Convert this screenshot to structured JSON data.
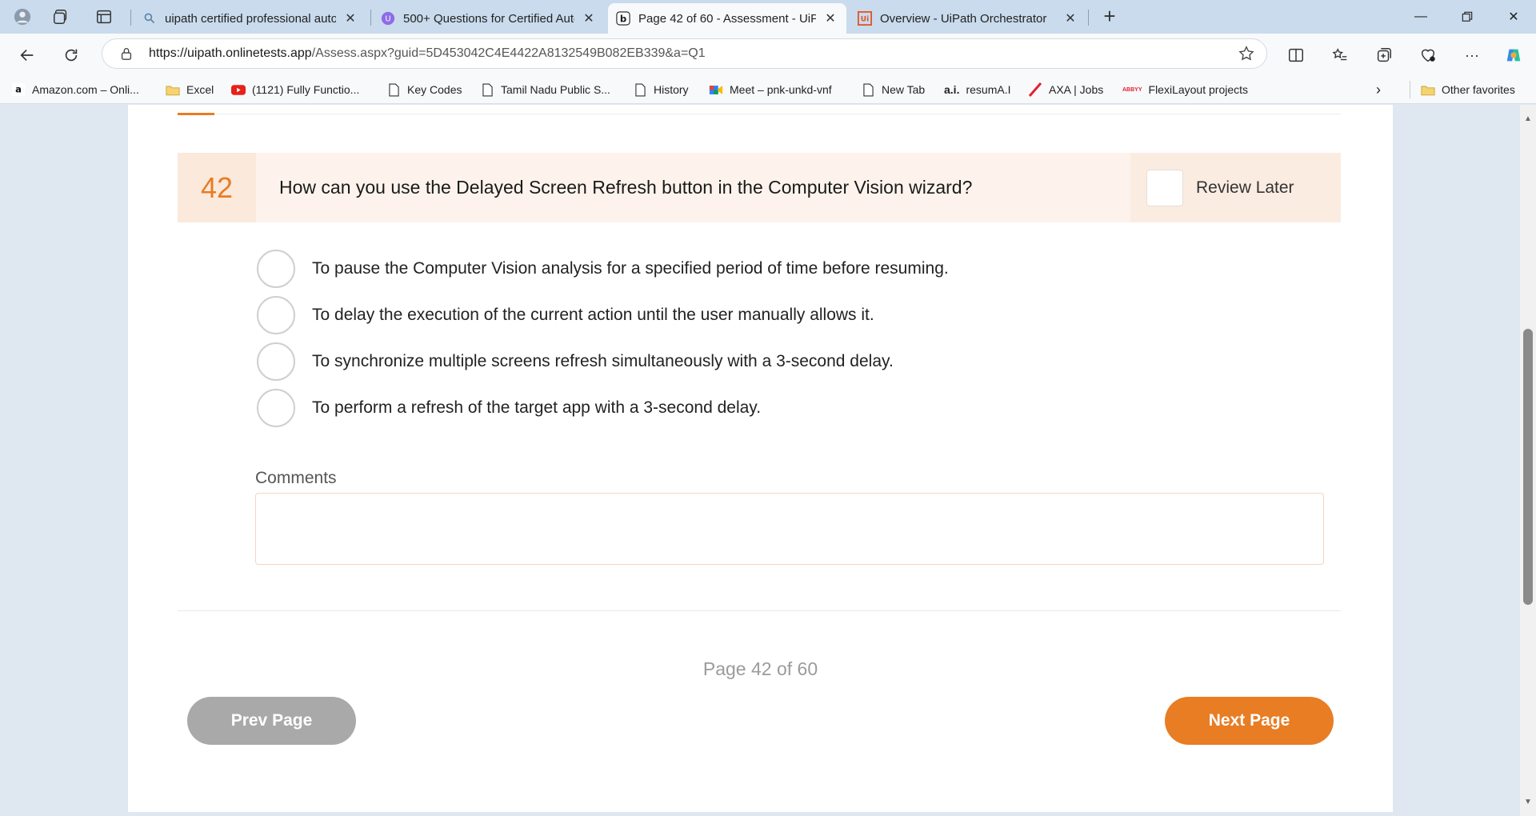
{
  "browser": {
    "tabs": [
      {
        "title": "uipath certified professional auto",
        "favicon": "search-icon",
        "active": false
      },
      {
        "title": "500+ Questions for Certified Auto",
        "favicon": "udemy-icon",
        "active": false
      },
      {
        "title": "Page 42 of 60 - Assessment - UiPa",
        "favicon": "bing-icon",
        "active": true
      },
      {
        "title": "Overview - UiPath Orchestrator",
        "favicon": "uipath-icon",
        "active": false
      }
    ],
    "address": {
      "host": "https://uipath.onlinetests.app",
      "path": "/Assess.aspx?guid=5D453042C4E4422A8132549B082EB339&a=Q1"
    },
    "bookmarks": [
      {
        "label": "Amazon.com – Onli...",
        "icon": "amazon-icon"
      },
      {
        "label": "Excel",
        "icon": "folder-icon"
      },
      {
        "label": "(1121) Fully Functio...",
        "icon": "youtube-icon"
      },
      {
        "label": "Key Codes",
        "icon": "page-icon"
      },
      {
        "label": "Tamil Nadu Public S...",
        "icon": "page-icon"
      },
      {
        "label": "History",
        "icon": "page-icon"
      },
      {
        "label": "Meet – pnk-unkd-vnf",
        "icon": "meet-icon"
      },
      {
        "label": "New Tab",
        "icon": "page-icon"
      },
      {
        "label": "resumA.I",
        "icon": "ai-icon"
      },
      {
        "label": "AXA | Jobs",
        "icon": "axa-icon"
      },
      {
        "label": "FlexiLayout projects",
        "icon": "abbyy-icon"
      }
    ],
    "other_favorites": "Other favorites",
    "ai_logo_text": "a.i.",
    "abbyy_logo_text": "ABBYY"
  },
  "question": {
    "number": "42",
    "text": "How can you use the Delayed Screen Refresh button in the Computer Vision wizard?",
    "review_label": "Review Later",
    "options": [
      "To pause the Computer Vision analysis for a specified period of time before resuming.",
      "To delay the execution of the current action until the user manually allows it.",
      "To synchronize multiple screens refresh simultaneously with a 3-second delay.",
      "To perform a refresh of the target app with a 3-second delay."
    ]
  },
  "comments": {
    "label": "Comments",
    "value": ""
  },
  "pagination": {
    "info": "Page 42 of 60",
    "prev_label": "Prev Page",
    "next_label": "Next Page"
  },
  "colors": {
    "accent": "#e87d24",
    "question_bar": "#fdf3ec",
    "prev_button": "#a9a9a9"
  }
}
